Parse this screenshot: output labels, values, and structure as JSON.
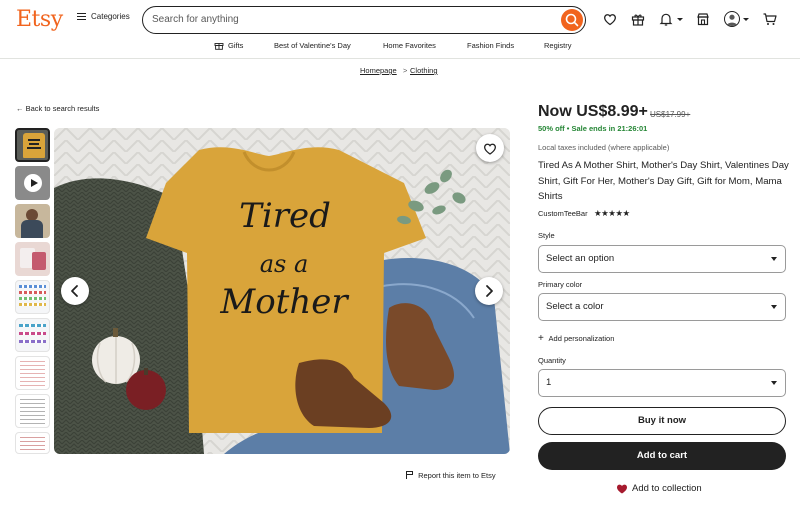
{
  "header": {
    "logo": "Etsy",
    "categories_label": "Categories",
    "search_placeholder": "Search for anything",
    "icons": [
      "search-icon",
      "heart-icon",
      "gift-icon",
      "bell-icon",
      "shop-icon",
      "avatar",
      "cart-icon"
    ]
  },
  "nav": {
    "items": [
      "Gifts",
      "Best of Valentine's Day",
      "Home Favorites",
      "Fashion Finds",
      "Registry"
    ]
  },
  "breadcrumb": {
    "items": [
      "Homepage",
      "Clothing"
    ],
    "separator": ">"
  },
  "gallery": {
    "back_label": "Back to search results",
    "report_label": "Report this item to Etsy",
    "shirt_text": [
      "Tired",
      "as a",
      "Mother"
    ]
  },
  "product": {
    "price_now": "Now US$8.99+",
    "price_old": "US$17.99+",
    "discount": "50% off",
    "sale_ends": "Sale ends in 21:26:01",
    "tax_note": "Local taxes included (where applicable)",
    "title": "Tired As A Mother Shirt, Mother's Day Shirt, Valentines Day Shirt, Gift For Her, Mother's Day Gift, Gift for Mom, Mama Shirts",
    "shop_name": "CustomTeeBar",
    "rating_stars": "★★★★★"
  },
  "form": {
    "style_label": "Style",
    "style_value": "Select an option",
    "color_label": "Primary color",
    "color_value": "Select a color",
    "personalization_label": "Add personalization",
    "quantity_label": "Quantity",
    "quantity_value": "1"
  },
  "actions": {
    "buy_now": "Buy it now",
    "add_to_cart": "Add to cart",
    "add_to_collection": "Add to collection"
  },
  "colors": {
    "brand": "#f1641e",
    "sale_green": "#258635",
    "shirt_mustard": "#d9a43a",
    "heart_red": "#a61a2e"
  }
}
